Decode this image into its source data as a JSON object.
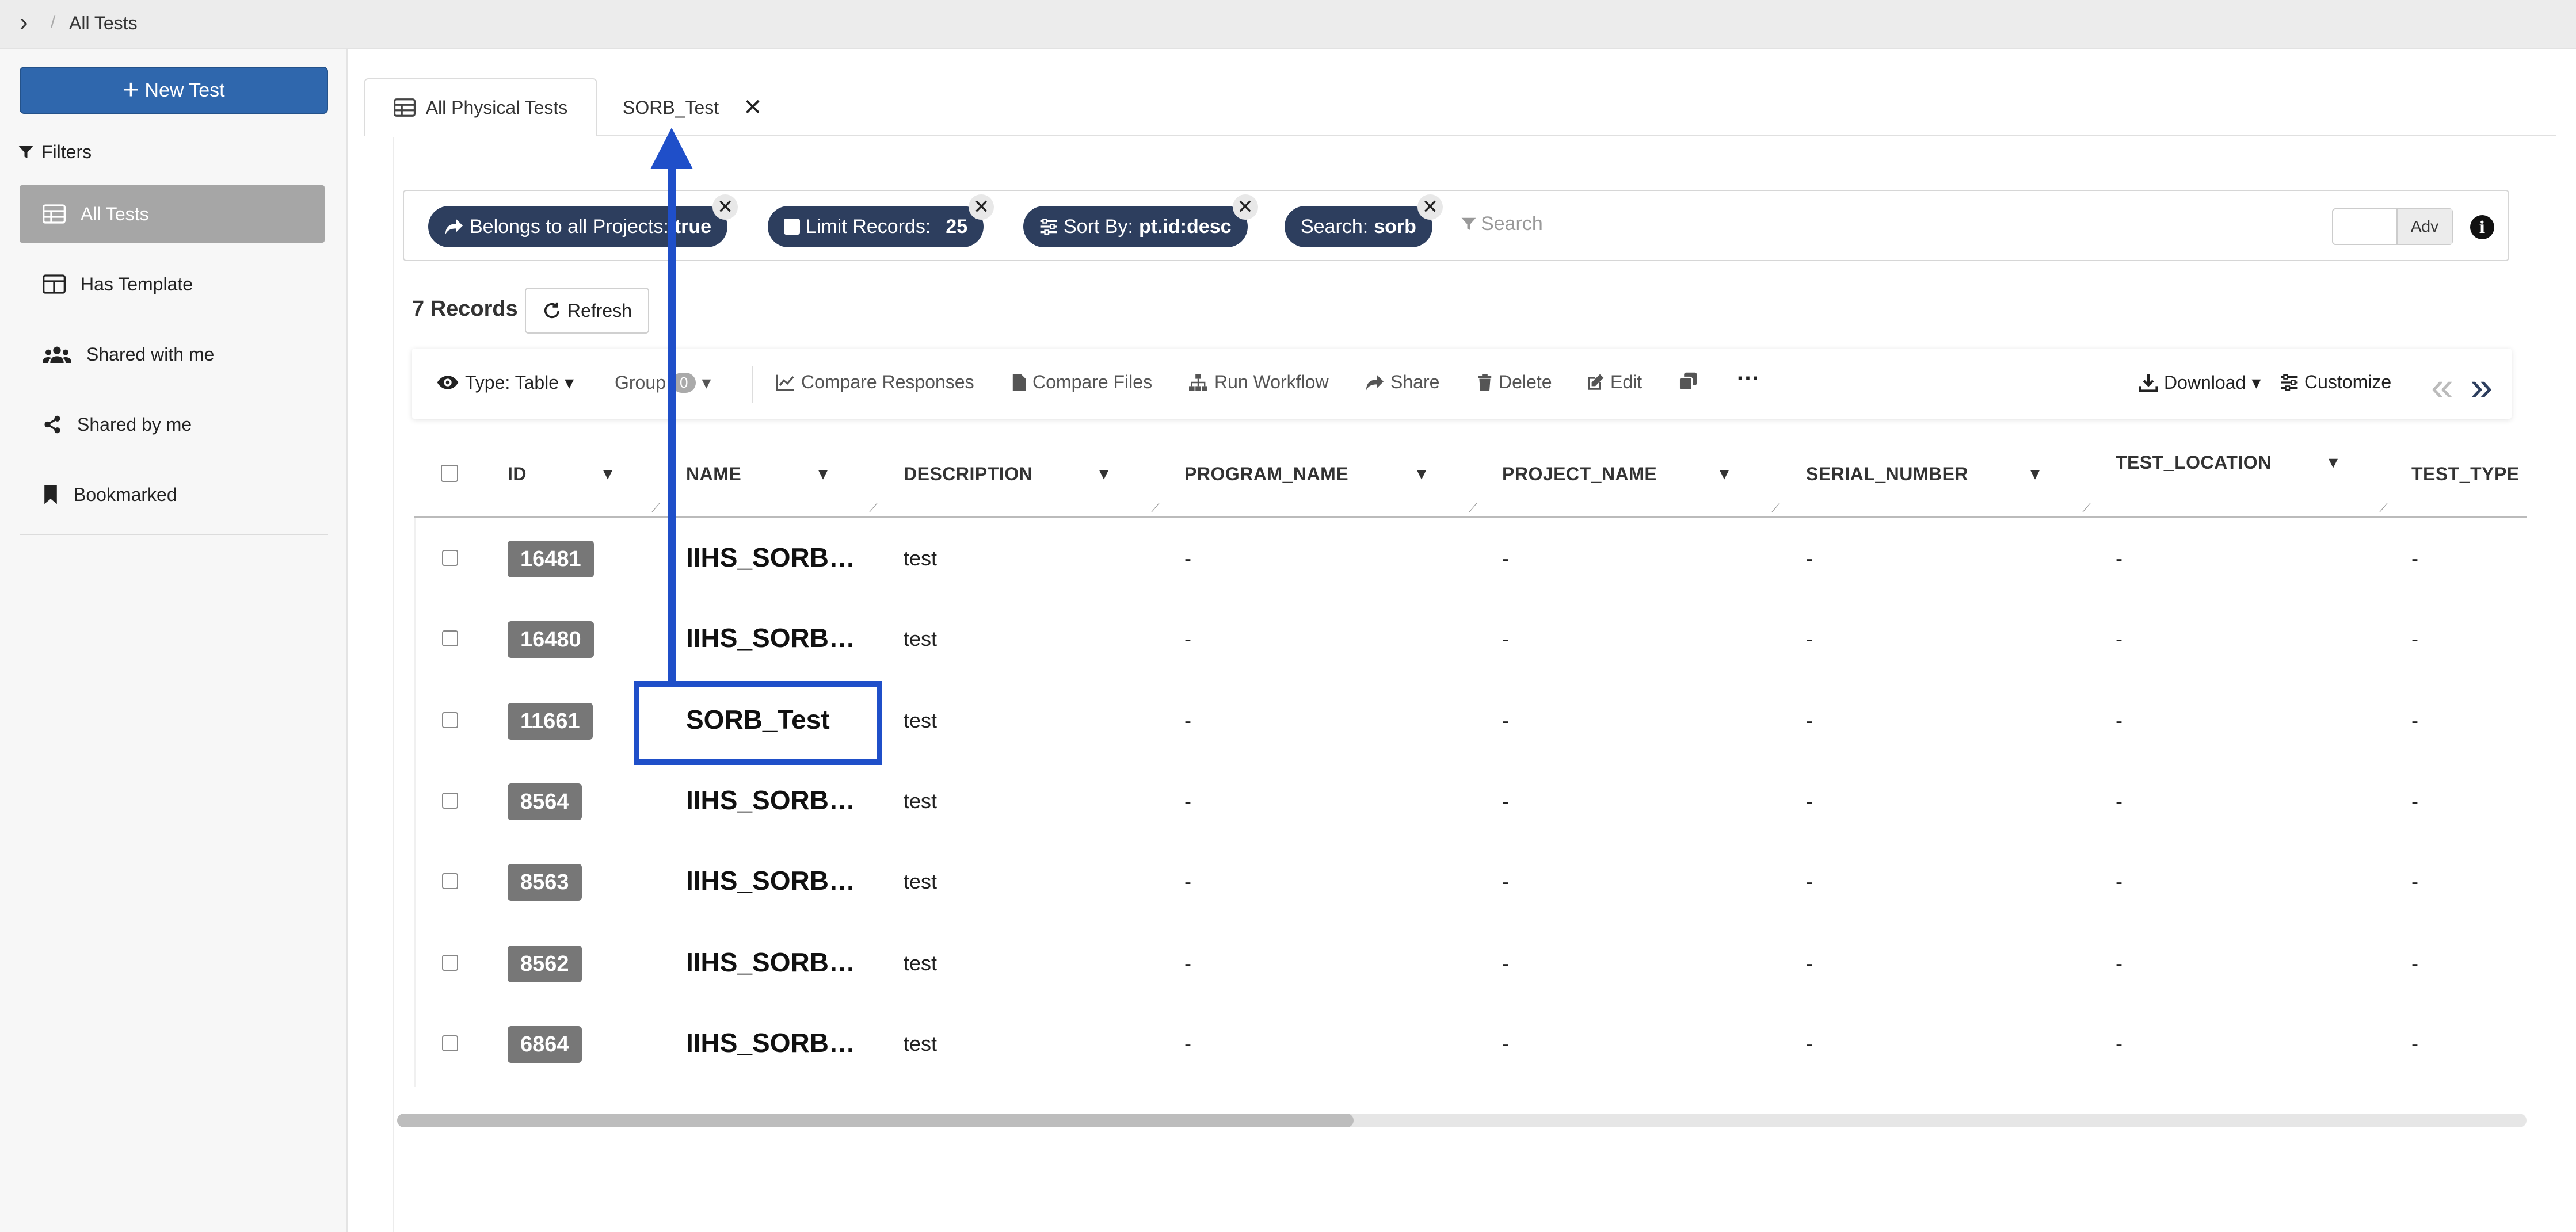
{
  "breadcrumb": {
    "expand_icon": "chevron-right-icon",
    "separator": "/",
    "current": "All Tests"
  },
  "sidebar": {
    "new_test_label": "New Test",
    "filters_label": "Filters",
    "items": [
      {
        "label": "All Tests",
        "icon": "table-icon",
        "active": true
      },
      {
        "label": "Has Template",
        "icon": "template-icon",
        "active": false
      },
      {
        "label": "Shared with me",
        "icon": "users-icon",
        "active": false
      },
      {
        "label": "Shared by me",
        "icon": "share-icon",
        "active": false
      },
      {
        "label": "Bookmarked",
        "icon": "bookmark-icon",
        "active": false
      }
    ]
  },
  "tabs": [
    {
      "label": "All Physical Tests",
      "active": true
    },
    {
      "label": "SORB_Test",
      "active": false,
      "closable": true
    }
  ],
  "chips": [
    {
      "label": "Belongs to all Projects:",
      "value": "true"
    },
    {
      "label": "Limit Records:",
      "value": "25"
    },
    {
      "label": "Sort By:",
      "value": "pt.id:desc"
    },
    {
      "label": "Search:",
      "value": "sorb"
    }
  ],
  "search": {
    "placeholder": "Search"
  },
  "adv_label": "Adv",
  "records": {
    "count_label": "7 Records",
    "refresh_label": "Refresh"
  },
  "toolbar": {
    "type_label": "Type: Table",
    "group_label": "Group",
    "group_count": "0",
    "compare_responses": "Compare Responses",
    "compare_files": "Compare Files",
    "run_workflow": "Run Workflow",
    "share": "Share",
    "delete": "Delete",
    "edit": "Edit",
    "more": "···",
    "download": "Download",
    "customize": "Customize"
  },
  "columns": [
    "ID",
    "NAME",
    "DESCRIPTION",
    "PROGRAM_NAME",
    "PROJECT_NAME",
    "SERIAL_NUMBER",
    "TEST_LOCATION",
    "TEST_TYPE"
  ],
  "rows": [
    {
      "id": "16481",
      "name": "IIHS_SORB…",
      "description": "test",
      "program_name": "-",
      "project_name": "-",
      "serial_number": "-",
      "test_location": "-",
      "test_type": "-"
    },
    {
      "id": "16480",
      "name": "IIHS_SORB…",
      "description": "test",
      "program_name": "-",
      "project_name": "-",
      "serial_number": "-",
      "test_location": "-",
      "test_type": "-"
    },
    {
      "id": "11661",
      "name": "SORB_Test",
      "description": "test",
      "program_name": "-",
      "project_name": "-",
      "serial_number": "-",
      "test_location": "-",
      "test_type": "-"
    },
    {
      "id": "8564",
      "name": "IIHS_SORB…",
      "description": "test",
      "program_name": "-",
      "project_name": "-",
      "serial_number": "-",
      "test_location": "-",
      "test_type": "-"
    },
    {
      "id": "8563",
      "name": "IIHS_SORB…",
      "description": "test",
      "program_name": "-",
      "project_name": "-",
      "serial_number": "-",
      "test_location": "-",
      "test_type": "-"
    },
    {
      "id": "8562",
      "name": "IIHS_SORB…",
      "description": "test",
      "program_name": "-",
      "project_name": "-",
      "serial_number": "-",
      "test_location": "-",
      "test_type": "-"
    },
    {
      "id": "6864",
      "name": "IIHS_SORB…",
      "description": "test",
      "program_name": "-",
      "project_name": "-",
      "serial_number": "-",
      "test_location": "-",
      "test_type": "-"
    }
  ],
  "colors": {
    "primary": "#2f67ad",
    "chip": "#2d3e5e",
    "annotation": "#1f4fc9",
    "id_badge": "#777777"
  }
}
